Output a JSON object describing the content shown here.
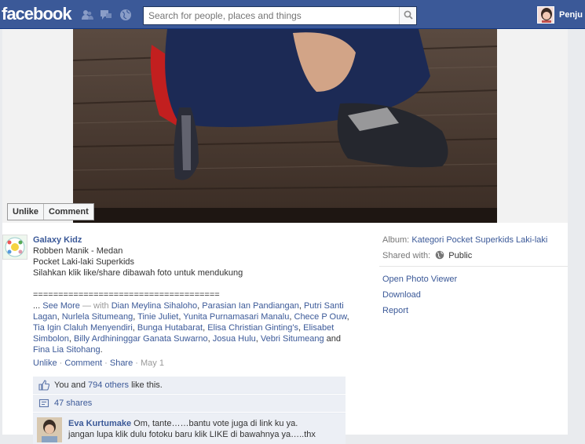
{
  "topbar": {
    "logo": "facebook",
    "search_placeholder": "Search for people, places and things",
    "user_name": "Penju"
  },
  "photo": {
    "unlike_label": "Unlike",
    "comment_label": "Comment"
  },
  "post": {
    "page_name": "Galaxy Kidz",
    "caption_lines": [
      "Robben Manik - Medan",
      "Pocket Laki-laki Superkids",
      "Silahkan klik like/share dibawah foto untuk mendukung"
    ],
    "divider": "=====================================",
    "ellipsis": "...",
    "see_more": "See More",
    "with_text": "— with",
    "tagged": [
      "Dian Meylina Sihaloho",
      "Parasian Ian Pandiangan",
      "Putri Santi Lagan",
      "Nurlela Situmeang",
      "Tinie Juliet",
      "Yunita Purnamasari Manalu",
      "Chece P Ouw",
      "Tia Igin Claluh Menyendiri",
      "Bunga Hutabarat",
      "Elisa Christian Ginting's",
      "Elisabet Simbolon",
      "Billy Ardhininggar Ganata Suwarno",
      "Josua Hulu",
      "Vebri Situmeang",
      "Fina Lia Sitohang"
    ],
    "and_text": "and",
    "actions": {
      "unlike": "Unlike",
      "comment": "Comment",
      "share": "Share",
      "date": "May 1"
    },
    "likes": {
      "prefix": "You and",
      "others": "794 others",
      "suffix": "like this."
    },
    "shares": "47 shares",
    "comment": {
      "author": "Eva Kurtumake",
      "text": "Om, tante……bantu vote juga di link ku ya.",
      "text2": "jangan lupa klik dulu fotoku baru klik LIKE di bawahnya ya…..thx"
    }
  },
  "sidebar": {
    "album_label": "Album:",
    "album_value": "Kategori Pocket Superkids Laki-laki",
    "shared_label": "Shared with:",
    "shared_value": "Public",
    "links": [
      "Open Photo Viewer",
      "Download",
      "Report"
    ]
  },
  "colors": {
    "brand": "#3b5998",
    "link": "#3b5998",
    "muted": "#999999"
  }
}
